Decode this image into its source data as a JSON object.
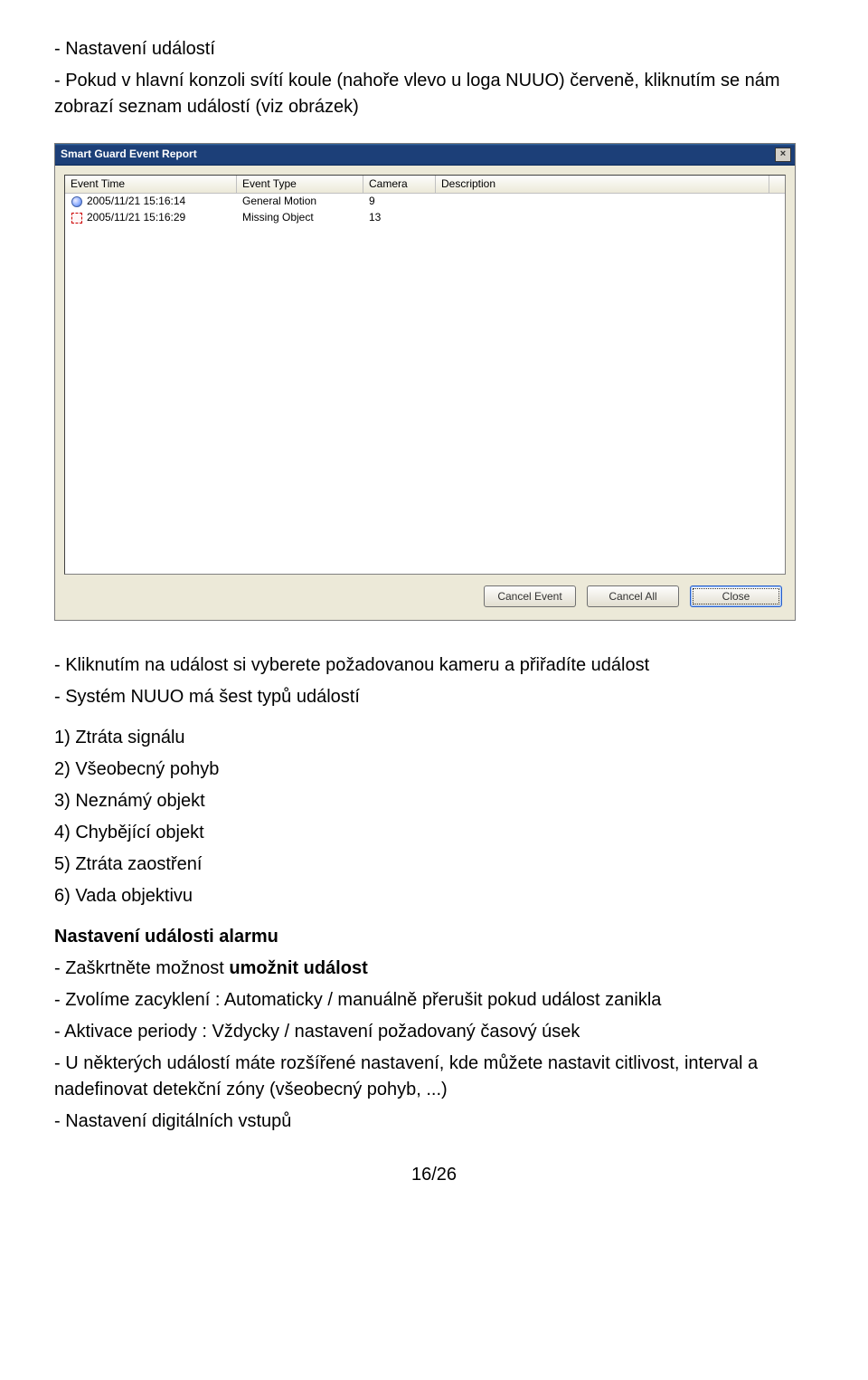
{
  "intro": {
    "line1": "- Nastavení událostí",
    "line2": "- Pokud v hlavní konzoli svítí koule (nahoře vlevo u loga NUUO) červeně, kliknutím se nám zobrazí seznam událostí (viz obrázek)"
  },
  "window": {
    "title": "Smart Guard Event Report",
    "close_label": "×",
    "columns": [
      "Event Time",
      "Event Type",
      "Camera",
      "Description"
    ],
    "rows": [
      {
        "icon": "motion",
        "time": "2005/11/21 15:16:14",
        "type": "General Motion",
        "camera": "9",
        "desc": ""
      },
      {
        "icon": "missing",
        "time": "2005/11/21 15:16:29",
        "type": "Missing Object",
        "camera": "13",
        "desc": ""
      }
    ],
    "buttons": {
      "cancel_event": "Cancel Event",
      "cancel_all": "Cancel All",
      "close": "Close"
    }
  },
  "after": {
    "p1": "- Kliknutím na událost si vyberete požadovanou kameru a přiřadíte událost",
    "p2": "- Systém NUUO má šest typů událostí",
    "list": [
      "1) Ztráta signálu",
      "2) Všeobecný pohyb",
      "3) Neznámý objekt",
      "4) Chybějící objekt",
      "5) Ztráta zaostření",
      "6) Vada objektivu"
    ],
    "heading": "Nastavení události alarmu",
    "b1a": "- Zaškrtněte možnost ",
    "b1b": "umožnit událost",
    "b2": "- Zvolíme zacyklení : Automaticky / manuálně přerušit pokud událost zanikla",
    "b3": "- Aktivace periody : Vždycky / nastavení požadovaný časový úsek",
    "b4": "- U některých událostí máte rozšířené nastavení, kde můžete nastavit citlivost, interval a nadefinovat detekční zóny (všeobecný pohyb, ...)",
    "b5": "- Nastavení digitálních vstupů"
  },
  "footer": "16/26"
}
